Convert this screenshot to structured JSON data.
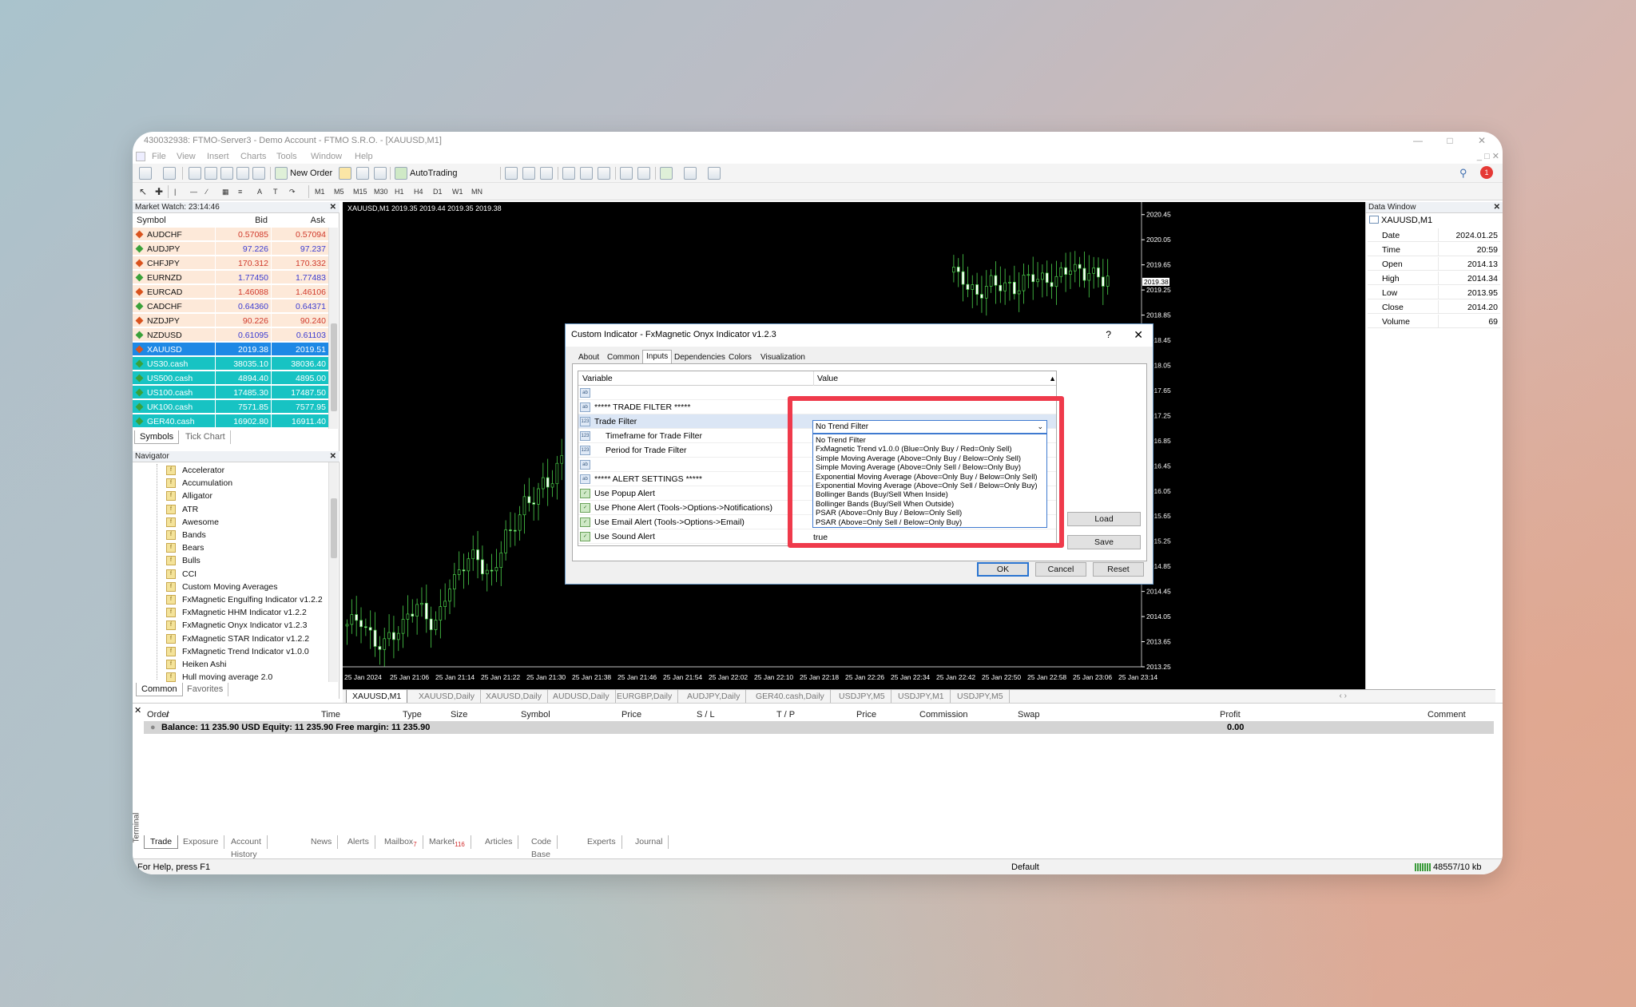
{
  "window": {
    "title": "430032938: FTMO-Server3 - Demo Account - FTMO S.R.O. - [XAUUSD,M1]"
  },
  "menu": [
    "File",
    "View",
    "Insert",
    "Charts",
    "Tools",
    "Window",
    "Help"
  ],
  "toolbar": {
    "new_order": "New Order",
    "autotrading": "AutoTrading",
    "timeframes": [
      "M1",
      "M5",
      "M15",
      "M30",
      "H1",
      "H4",
      "D1",
      "W1",
      "MN"
    ],
    "notification_count": "1"
  },
  "market_watch": {
    "title": "Market Watch: 23:14:46",
    "headers": {
      "symbol": "Symbol",
      "bid": "Bid",
      "ask": "Ask"
    },
    "rows": [
      {
        "symbol": "AUDCHF",
        "bid": "0.57085",
        "ask": "0.57094",
        "dir": "down"
      },
      {
        "symbol": "AUDJPY",
        "bid": "97.226",
        "ask": "97.237",
        "dir": "up"
      },
      {
        "symbol": "CHFJPY",
        "bid": "170.312",
        "ask": "170.332",
        "dir": "down"
      },
      {
        "symbol": "EURNZD",
        "bid": "1.77450",
        "ask": "1.77483",
        "dir": "up"
      },
      {
        "symbol": "EURCAD",
        "bid": "1.46088",
        "ask": "1.46106",
        "dir": "down"
      },
      {
        "symbol": "CADCHF",
        "bid": "0.64360",
        "ask": "0.64371",
        "dir": "up"
      },
      {
        "symbol": "NZDJPY",
        "bid": "90.226",
        "ask": "90.240",
        "dir": "down"
      },
      {
        "symbol": "NZDUSD",
        "bid": "0.61095",
        "ask": "0.61103",
        "dir": "up"
      },
      {
        "symbol": "XAUUSD",
        "bid": "2019.38",
        "ask": "2019.51",
        "dir": "down"
      },
      {
        "symbol": "US30.cash",
        "bid": "38035.10",
        "ask": "38036.40",
        "dir": "up"
      },
      {
        "symbol": "US500.cash",
        "bid": "4894.40",
        "ask": "4895.00",
        "dir": "up"
      },
      {
        "symbol": "US100.cash",
        "bid": "17485.30",
        "ask": "17487.50",
        "dir": "up"
      },
      {
        "symbol": "UK100.cash",
        "bid": "7571.85",
        "ask": "7577.95",
        "dir": "up"
      },
      {
        "symbol": "GER40.cash",
        "bid": "16902.80",
        "ask": "16911.40",
        "dir": "up"
      }
    ],
    "tabs": [
      "Symbols",
      "Tick Chart"
    ]
  },
  "navigator": {
    "title": "Navigator",
    "items": [
      "Accelerator",
      "Accumulation",
      "Alligator",
      "ATR",
      "Awesome",
      "Bands",
      "Bears",
      "Bulls",
      "CCI",
      "Custom Moving Averages",
      "FxMagnetic Engulfing Indicator v1.2.2",
      "FxMagnetic HHM Indicator v1.2.2",
      "FxMagnetic Onyx Indicator v1.2.3",
      "FxMagnetic STAR Indicator v1.2.2",
      "FxMagnetic Trend Indicator v1.0.0",
      "Heiken Ashi",
      "Hull moving average 2.0"
    ],
    "tabs": [
      "Common",
      "Favorites"
    ]
  },
  "chart": {
    "header": "XAUUSD,M1  2019.35 2019.44 2019.35 2019.38",
    "price_labels": [
      "2020.45",
      "2020.05",
      "2019.65",
      "2019.25",
      "2018.85",
      "2018.45",
      "2018.05",
      "2017.65",
      "2017.25",
      "2016.85",
      "2016.45",
      "2016.05",
      "2015.65",
      "2015.25",
      "2014.85",
      "2014.45",
      "2014.05",
      "2013.65",
      "2013.25"
    ],
    "current_price": "2019.38",
    "time_labels": [
      "25 Jan 2024",
      "25 Jan 21:06",
      "25 Jan 21:14",
      "25 Jan 21:22",
      "25 Jan 21:30",
      "25 Jan 21:38",
      "25 Jan 21:46",
      "25 Jan 21:54",
      "25 Jan 22:02",
      "25 Jan 22:10",
      "25 Jan 22:18",
      "25 Jan 22:26",
      "25 Jan 22:34",
      "25 Jan 22:42",
      "25 Jan 22:50",
      "25 Jan 22:58",
      "25 Jan 23:06",
      "25 Jan 23:14"
    ],
    "tabs": [
      "XAUUSD,M1",
      "XAUUSD,Daily",
      "XAUUSD,Daily",
      "AUDUSD,Daily",
      "EURGBP,Daily",
      "AUDJPY,Daily",
      "GER40.cash,Daily",
      "USDJPY,M5",
      "USDJPY,M1",
      "USDJPY,M5"
    ],
    "candle_closes": [
      2014.0,
      2013.6,
      2013.8,
      2014.2,
      2013.9,
      2014.6,
      2015.0,
      2014.7,
      2015.4,
      2015.9,
      2016.2,
      2016.6,
      2016.4,
      2017.0,
      2017.3,
      2017.6,
      2017.9,
      2018.1,
      2017.9,
      2018.2,
      2018.0,
      2017.8,
      2018.1,
      2017.9,
      2018.0,
      2018.2,
      2018.1,
      2018.3,
      2018.6,
      2018.9,
      2019.3,
      2019.8,
      2019.5,
      2019.2,
      2019.4,
      2019.3,
      2019.5,
      2019.4,
      2019.6,
      2019.5,
      2019.4
    ]
  },
  "data_window": {
    "title": "Data Window",
    "symbol": "XAUUSD,M1",
    "rows": [
      {
        "k": "Date",
        "v": "2024.01.25"
      },
      {
        "k": "Time",
        "v": "20:59"
      },
      {
        "k": "Open",
        "v": "2014.13"
      },
      {
        "k": "High",
        "v": "2014.34"
      },
      {
        "k": "Low",
        "v": "2013.95"
      },
      {
        "k": "Close",
        "v": "2014.20"
      },
      {
        "k": "Volume",
        "v": "69"
      }
    ]
  },
  "dialog": {
    "title": "Custom Indicator - FxMagnetic Onyx Indicator v1.2.3",
    "help": "?",
    "tabs": [
      "About",
      "Common",
      "Inputs",
      "Dependencies",
      "Colors",
      "Visualization"
    ],
    "active_tab": "Inputs",
    "col_variable": "Variable",
    "col_value": "Value",
    "rows": [
      {
        "name": "",
        "icon": "ab"
      },
      {
        "name": "***** TRADE FILTER *****",
        "icon": "ab"
      },
      {
        "name": "Trade Filter",
        "icon": "123"
      },
      {
        "name": "Timeframe for Trade Filter",
        "icon": "123"
      },
      {
        "name": "Period for Trade Filter",
        "icon": "123"
      },
      {
        "name": "",
        "icon": "ab"
      },
      {
        "name": "***** ALERT SETTINGS *****",
        "icon": "ab"
      },
      {
        "name": "Use Popup Alert",
        "icon": "bool"
      },
      {
        "name": "Use Phone Alert (Tools->Options->Notifications)",
        "icon": "bool"
      },
      {
        "name": "Use Email Alert (Tools->Options->Email)",
        "icon": "bool"
      },
      {
        "name": "Use Sound Alert",
        "icon": "bool"
      }
    ],
    "last_value": "true",
    "dropdown_selected": "No Trend Filter",
    "dropdown_options": [
      "No Trend Filter",
      "FxMagnetic Trend v1.0.0 (Blue=Only Buy / Red=Only Sell)",
      "Simple Moving Average (Above=Only Buy / Below=Only Sell)",
      "Simple Moving Average (Above=Only Sell / Below=Only Buy)",
      "Exponential Moving Average (Above=Only Buy / Below=Only Sell)",
      "Exponential Moving Average (Above=Only Sell / Below=Only Buy)",
      "Bollinger Bands (Buy/Sell When Inside)",
      "Bollinger Bands (Buy/Sell When Outside)",
      "PSAR (Above=Only Buy / Below=Only Sell)",
      "PSAR (Above=Only Sell / Below=Only Buy)"
    ],
    "buttons": {
      "load": "Load",
      "save": "Save",
      "ok": "OK",
      "cancel": "Cancel",
      "reset": "Reset"
    }
  },
  "terminal": {
    "headers": [
      "Order",
      "/",
      "Time",
      "Type",
      "Size",
      "Symbol",
      "Price",
      "S / L",
      "T / P",
      "Price",
      "Commission",
      "Swap",
      "Profit",
      "Comment"
    ],
    "balance": "Balance: 11 235.90 USD  Equity: 11 235.90  Free margin: 11 235.90",
    "profit": "0.00",
    "side_label": "Terminal",
    "tabs": [
      {
        "label": "Trade",
        "badge": ""
      },
      {
        "label": "Exposure",
        "badge": ""
      },
      {
        "label": "Account History",
        "badge": ""
      },
      {
        "label": "News",
        "badge": ""
      },
      {
        "label": "Alerts",
        "badge": ""
      },
      {
        "label": "Mailbox",
        "badge": "7"
      },
      {
        "label": "Market",
        "badge": "116"
      },
      {
        "label": "Articles",
        "badge": ""
      },
      {
        "label": "Code Base",
        "badge": ""
      },
      {
        "label": "Experts",
        "badge": ""
      },
      {
        "label": "Journal",
        "badge": ""
      }
    ]
  },
  "status": {
    "help": "For Help, press F1",
    "profile": "Default",
    "connection": "48557/10 kb"
  },
  "colors": {
    "highlight": "#ef3a4b",
    "selected_row": "#1e88e5",
    "index_row": "#17c3c3",
    "fx_row": "#fde9d9",
    "candle": "#4cd34c"
  }
}
